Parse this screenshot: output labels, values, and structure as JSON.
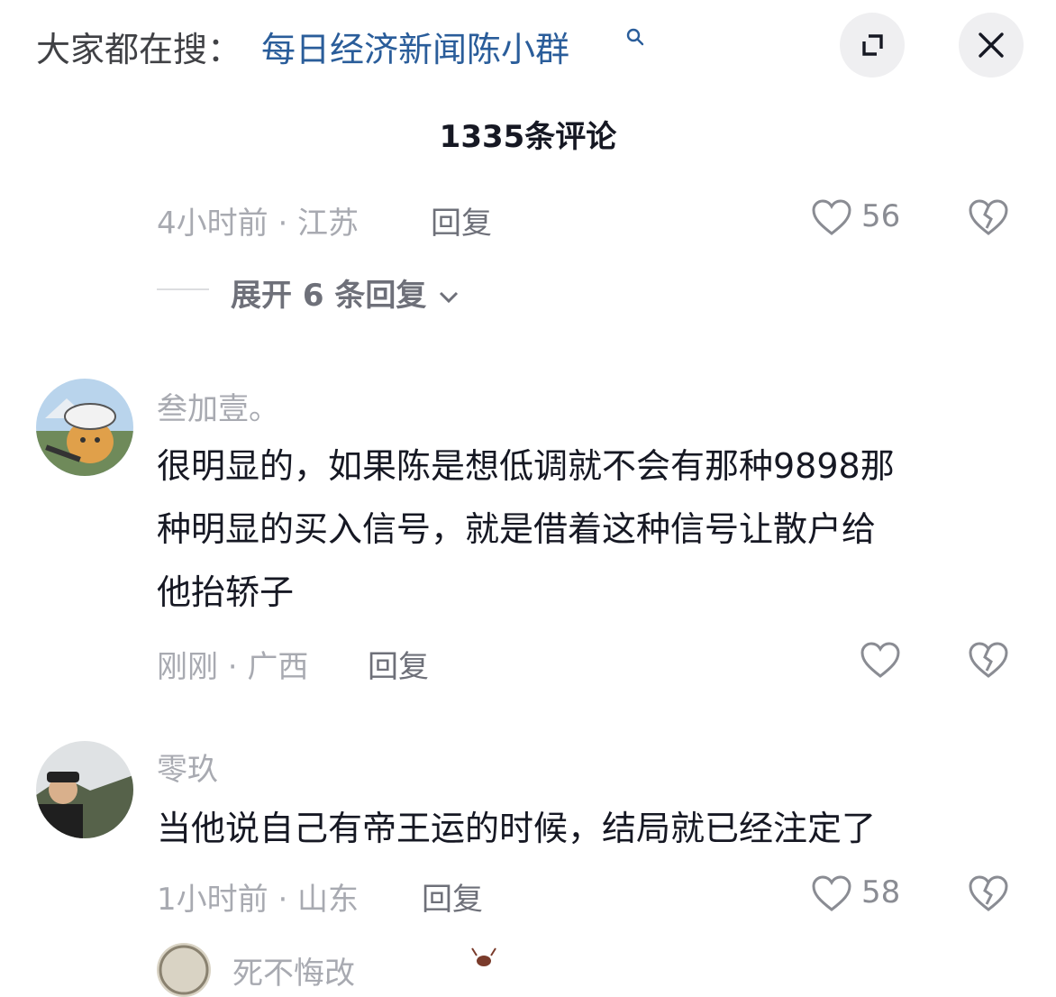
{
  "search": {
    "prefix": "大家都在搜：",
    "term": "每日经济新闻陈小群"
  },
  "header": {
    "title": "1335条评论"
  },
  "icons": {
    "search": "search-icon",
    "collapse": "collapse-icon",
    "close": "close-icon",
    "like": "heart-icon",
    "dislike": "broken-heart-icon",
    "expand": "chevron-down-icon"
  },
  "comments": [
    {
      "meta": "4小时前 · 江苏",
      "reply_label": "回复",
      "likes": "56",
      "expand_label": "展开 6 条回复"
    },
    {
      "username": "叁加壹。",
      "text_lines": [
        "很明显的，如果陈是想低调就不会有那种9898那",
        "种明显的买入信号，就是借着这种信号让散户给",
        "他抬轿子"
      ],
      "meta": "刚刚 · 广西",
      "reply_label": "回复"
    },
    {
      "username": "零玖",
      "text_lines": [
        "当他说自己有帝王运的时候，结局就已经注定了"
      ],
      "meta": "1小时前 · 山东",
      "reply_label": "回复",
      "likes": "58"
    },
    {
      "username_partial": "死不悔改"
    }
  ],
  "colors": {
    "accent_link": "#2a5d9a",
    "text_primary": "#161823",
    "text_secondary": "#a8aab1",
    "button_bg": "#efeff1"
  }
}
